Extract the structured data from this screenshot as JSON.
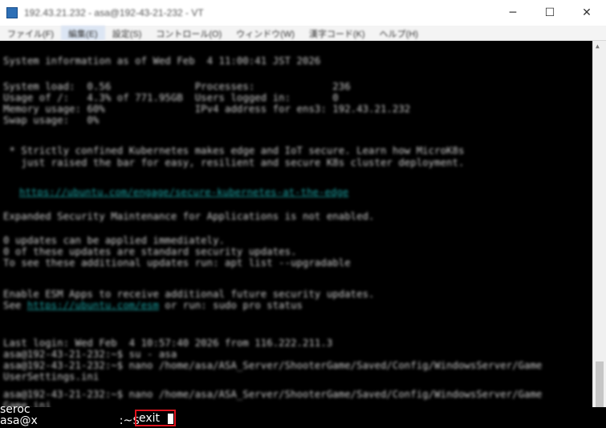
{
  "window": {
    "title": "192.43.21.232 - asa@192-43-21-232 - VT",
    "controls": {
      "minimize": "─",
      "maximize": "☐",
      "close": "✕"
    }
  },
  "menu": [
    "ファイル(F)",
    "編集(E)",
    "設定(S)",
    "コントロール(O)",
    "ウィンドウ(W)",
    "漢字コード(K)",
    "ヘルプ(H)"
  ],
  "terminal": {
    "sysinfo_header": "System information as of Wed Feb  4 11:00:41 JST 2026",
    "sysinfo": [
      "System load:  0.56              Processes:             236",
      "Usage of /:   4.3% of 771.95GB  Users logged in:       0",
      "Memory usage: 60%               IPv4 address for ens3: 192.43.21.232",
      "Swap usage:   0%"
    ],
    "microk8s": [
      " * Strictly confined Kubernetes makes edge and IoT secure. Learn how MicroK8s",
      "   just raised the bar for easy, resilient and secure K8s cluster deployment."
    ],
    "microk8s_link": "https://ubuntu.com/engage/secure-kubernetes-at-the-edge",
    "esm": "Expanded Security Maintenance for Applications is not enabled.",
    "updates": [
      "0 updates can be applied immediately.",
      "0 of these updates are standard security updates.",
      "To see these additional updates run: apt list --upgradable"
    ],
    "esm_apps_1": "Enable ESM Apps to receive additional future security updates.",
    "esm_apps_2_prefix": "See ",
    "esm_apps_link": "https://ubuntu.com/esm",
    "esm_apps_2_suffix": " or run: sudo pro status",
    "history": [
      "Last login: Wed Feb  4 10:57:40 2026 from 116.222.211.3",
      "asa@192-43-21-232:~$ su - asa",
      "asa@192-43-21-232:~$ nano /home/asa/ASA_Server/ShooterGame/Saved/Config/WindowsServer/Game",
      "UserSettings.ini",
      "asa@192-43-21-232:~$ nano /home/asa/ASA_Server/ShooterGame/Saved/Config/WindowsServer/Game",
      "Game.ini"
    ],
    "bottom_line1": "seroc",
    "prompt_user": "asa@x",
    "prompt_tail": ":~$",
    "command": "exit"
  }
}
